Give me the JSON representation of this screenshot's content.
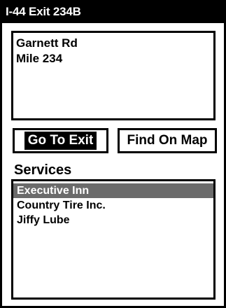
{
  "window": {
    "title": "I-44 Exit 234B"
  },
  "info": {
    "lines": [
      "Garnett Rd",
      "Mile 234"
    ]
  },
  "buttons": {
    "go_to_exit": "Go To Exit",
    "find_on_map": "Find On Map"
  },
  "services": {
    "label": "Services",
    "items": [
      "Executive Inn",
      "Country Tire Inc.",
      "Jiffy Lube"
    ],
    "selected_index": 0
  },
  "colors": {
    "selection": "#6b6b6b",
    "title_bg": "#000000"
  }
}
